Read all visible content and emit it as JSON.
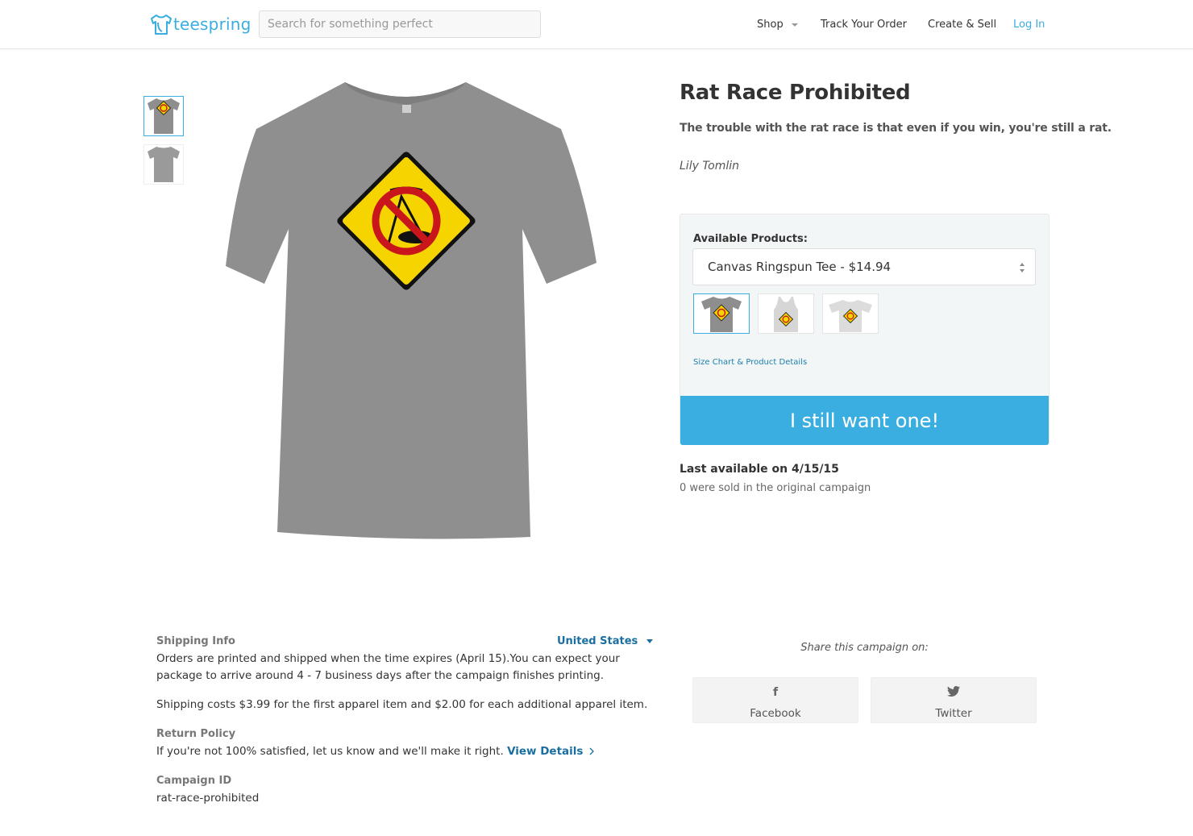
{
  "header": {
    "logo_text": "teespring",
    "search_placeholder": "Search for something perfect",
    "nav": {
      "shop": "Shop",
      "track": "Track Your Order",
      "create": "Create & Sell",
      "login": "Log In"
    }
  },
  "colors": {
    "accent": "#3aaee0",
    "link_dark": "#1b6fa0",
    "shirt_gray": "#8e8e8e",
    "sign_yellow": "#f5d400",
    "prohibit_red": "#c9161d"
  },
  "campaign": {
    "title": "Rat Race Prohibited",
    "description": "The trouble with the rat race is that even if you win, you're still a rat.",
    "quote_author": "Lily Tomlin",
    "available_label": "Available Products:",
    "selected_product": "Canvas Ringspun Tee - $14.94",
    "size_chart_link": "Size Chart & Product Details",
    "cta_label": "I still want one!",
    "last_available": "Last available on 4/15/15",
    "sold_text": "0 were sold in the original campaign"
  },
  "info": {
    "shipping_heading": "Shipping Info",
    "country": "United States",
    "shipping_text": "Orders are printed and shipped when the time expires (April 15).You can expect your package to arrive around 4 - 7 business days after the campaign finishes printing.",
    "shipping_cost": "Shipping costs $3.99 for the first apparel item and $2.00 for each additional apparel item.",
    "return_heading": "Return Policy",
    "return_text": "If you're not 100% satisfied, let us know and we'll make it right.",
    "return_link": "View Details",
    "campaign_id_heading": "Campaign ID",
    "campaign_id": "rat-race-prohibited"
  },
  "share": {
    "label": "Share this campaign on:",
    "facebook": "Facebook",
    "twitter": "Twitter",
    "facebook_icon": "f",
    "twitter_icon": "🐦"
  }
}
